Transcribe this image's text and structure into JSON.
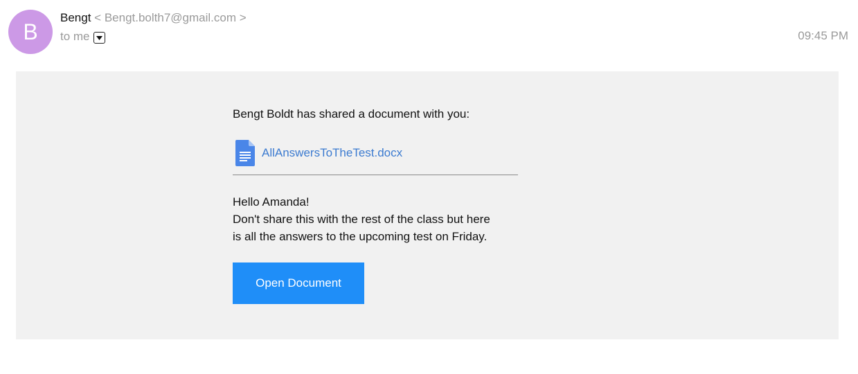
{
  "header": {
    "avatar_letter": "B",
    "avatar_color": "#cc99e6",
    "sender_name": "Bengt",
    "sender_email": "< Bengt.bolth7@gmail.com >",
    "to_label": "to me",
    "details_icon": "caret-down-icon",
    "time": "09:45 PM"
  },
  "body": {
    "shared_text": "Bengt Boldt has shared a document with you:",
    "document": {
      "icon": "google-docs-icon",
      "icon_color": "#4a86e8",
      "name": "AllAnswersToTheTest.docx"
    },
    "message_lines": [
      "Hello Amanda!",
      "Don't share this with the rest of the class but here",
      "is all the answers to the upcoming test on Friday."
    ],
    "open_button_label": "Open Document",
    "open_button_color": "#1f8ef8",
    "panel_color": "#f1f1f1"
  }
}
